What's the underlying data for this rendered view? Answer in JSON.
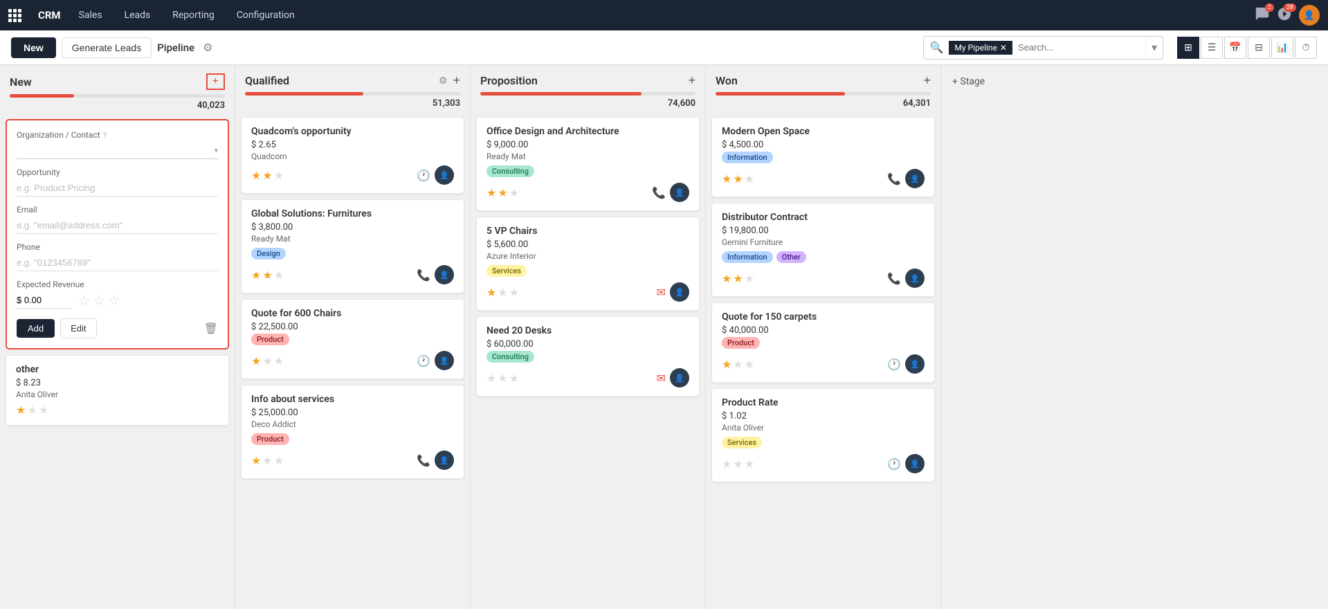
{
  "nav": {
    "app_name": "CRM",
    "links": [
      "Sales",
      "Leads",
      "Reporting",
      "Configuration"
    ],
    "badge_messages": "2",
    "badge_activity": "28"
  },
  "toolbar": {
    "new_label": "New",
    "generate_label": "Generate Leads",
    "pipeline_label": "Pipeline",
    "filter_tag": "My Pipeline",
    "search_placeholder": "Search..."
  },
  "columns": [
    {
      "id": "new",
      "title": "New",
      "amount": "40,023",
      "progress": 30,
      "has_settings": false,
      "cards": []
    },
    {
      "id": "qualified",
      "title": "Qualified",
      "amount": "51,303",
      "progress": 55,
      "has_settings": true,
      "cards": [
        {
          "title": "Quadcom's opportunity",
          "amount": "$ 2.65",
          "company": "Quadcom",
          "tags": [],
          "stars": 2,
          "action": "clock"
        },
        {
          "title": "Global Solutions: Furnitures",
          "amount": "$ 3,800.00",
          "company": "Ready Mat",
          "tags": [
            {
              "label": "Design",
              "class": "tag-design"
            }
          ],
          "stars": 2,
          "action": "phone"
        },
        {
          "title": "Quote for 600 Chairs",
          "amount": "$ 22,500.00",
          "company": "",
          "tags": [
            {
              "label": "Product",
              "class": "tag-product"
            }
          ],
          "stars": 1,
          "action": "clock"
        },
        {
          "title": "Info about services",
          "amount": "$ 25,000.00",
          "company": "Deco Addict",
          "tags": [
            {
              "label": "Product",
              "class": "tag-product"
            }
          ],
          "stars": 1,
          "action": "phone"
        }
      ]
    },
    {
      "id": "proposition",
      "title": "Proposition",
      "amount": "74,600",
      "progress": 75,
      "has_settings": false,
      "cards": [
        {
          "title": "Office Design and Architecture",
          "amount": "$ 9,000.00",
          "company": "Ready Mat",
          "tags": [
            {
              "label": "Consulting",
              "class": "tag-consulting"
            }
          ],
          "stars": 2,
          "action": "phone"
        },
        {
          "title": "5 VP Chairs",
          "amount": "$ 5,600.00",
          "company": "Azure Interior",
          "tags": [
            {
              "label": "Services",
              "class": "tag-services"
            }
          ],
          "stars": 1,
          "action": "email"
        },
        {
          "title": "Need 20 Desks",
          "amount": "$ 60,000.00",
          "company": "",
          "tags": [
            {
              "label": "Consulting",
              "class": "tag-consulting"
            }
          ],
          "stars": 0,
          "action": "email"
        }
      ]
    },
    {
      "id": "won",
      "title": "Won",
      "amount": "64,301",
      "progress": 60,
      "has_settings": false,
      "cards": [
        {
          "title": "Modern Open Space",
          "amount": "$ 4,500.00",
          "company": "",
          "tags": [
            {
              "label": "Information",
              "class": "tag-information"
            }
          ],
          "stars": 2,
          "action": "phone"
        },
        {
          "title": "Distributor Contract",
          "amount": "$ 19,800.00",
          "company": "Gemini Furniture",
          "tags": [
            {
              "label": "Information",
              "class": "tag-information"
            },
            {
              "label": "Other",
              "class": "tag-other"
            }
          ],
          "stars": 2,
          "action": "phone"
        },
        {
          "title": "Quote for 150 carpets",
          "amount": "$ 40,000.00",
          "company": "",
          "tags": [
            {
              "label": "Product",
              "class": "tag-product"
            }
          ],
          "stars": 1,
          "action": "clock"
        },
        {
          "title": "Product Rate",
          "amount": "$ 1.02",
          "company": "Anita Oliver",
          "tags": [
            {
              "label": "Services",
              "class": "tag-services"
            }
          ],
          "stars": 0,
          "action": "clock"
        }
      ]
    }
  ],
  "new_form": {
    "org_contact_label": "Organization / Contact",
    "org_contact_help": "?",
    "opportunity_label": "Opportunity",
    "opportunity_placeholder": "e.g. Product Pricing",
    "email_label": "Email",
    "email_placeholder": "e.g. \"email@address.com\"",
    "phone_label": "Phone",
    "phone_placeholder": "e.g. \"0123456789\"",
    "revenue_label": "Expected Revenue",
    "revenue_value": "$ 0.00",
    "add_label": "Add",
    "edit_label": "Edit"
  },
  "other_card": {
    "title": "other",
    "amount": "$ 8.23",
    "company": "Anita Oliver"
  },
  "add_stage_label": "+ Stage"
}
